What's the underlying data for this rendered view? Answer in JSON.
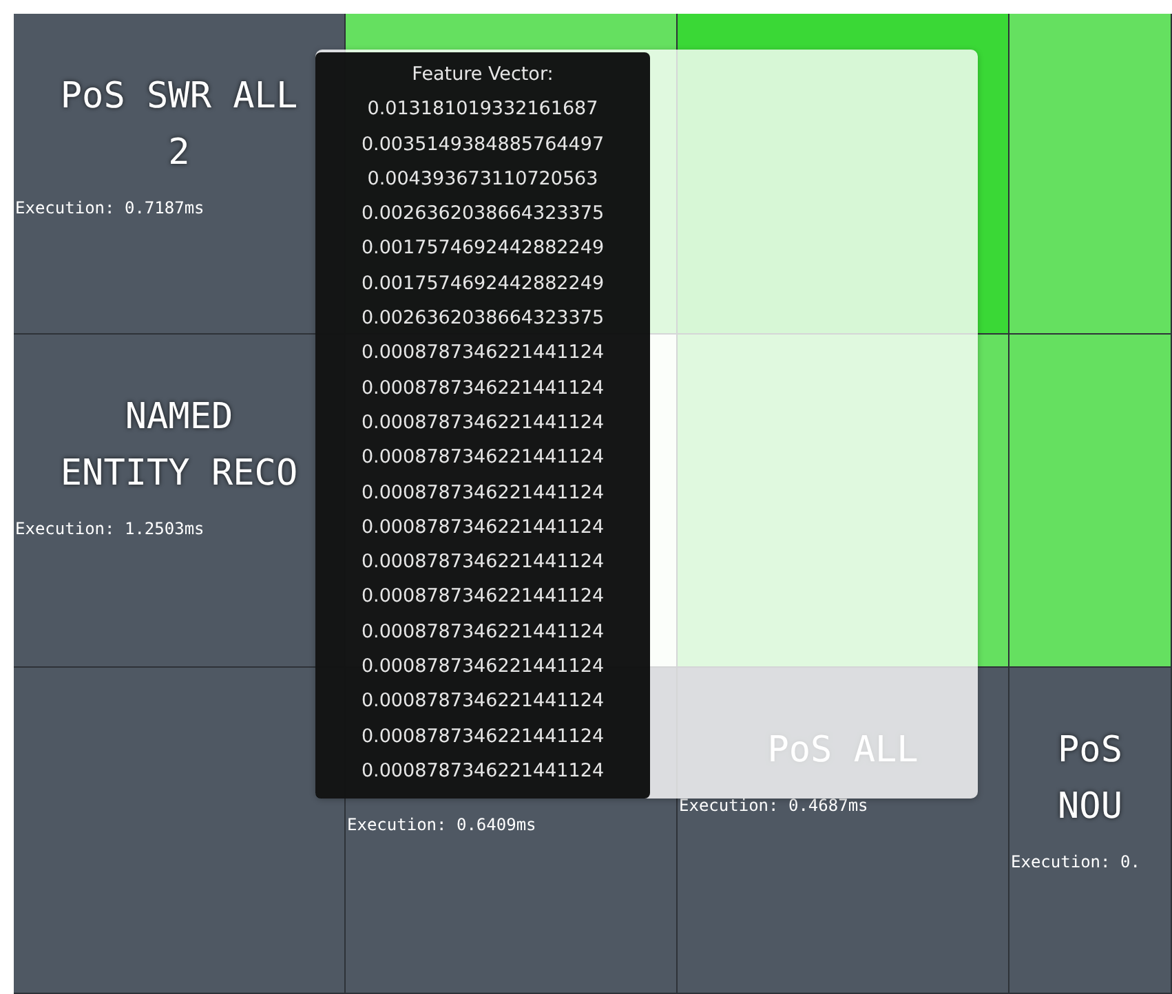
{
  "grid": {
    "cells": [
      {
        "kind": "model",
        "title": "PoS SWR ALL 2",
        "execution": "Execution: 0.7187ms"
      },
      {
        "kind": "swatch",
        "color": "#65e060"
      },
      {
        "kind": "swatch",
        "color": "#3ad836"
      },
      {
        "kind": "swatch",
        "color": "#65e060"
      },
      {
        "kind": "model",
        "title": "NAMED ENTITY RECO",
        "execution": "Execution: 1.2503ms"
      },
      {
        "kind": "covered"
      },
      {
        "kind": "swatch",
        "color": "#65e060"
      },
      {
        "kind": "swatch",
        "color": "#65e060"
      },
      {
        "kind": "model"
      },
      {
        "kind": "model",
        "execution": "Execution: 0.6409ms"
      },
      {
        "kind": "model",
        "title": "PoS ALL",
        "execution": "Execution: 0.4687ms"
      },
      {
        "kind": "model",
        "title": "PoS NOU",
        "execution": "Execution: 0."
      }
    ]
  },
  "tooltip": {
    "heading": "Feature Vector:",
    "values": [
      "0.013181019332161687",
      "0.0035149384885764497",
      "0.004393673110720563",
      "0.0026362038664323375",
      "0.0017574692442882249",
      "0.0017574692442882249",
      "0.0026362038664323375",
      "0.0008787346221441124",
      "0.0008787346221441124",
      "0.0008787346221441124",
      "0.0008787346221441124",
      "0.0008787346221441124",
      "0.0008787346221441124",
      "0.0008787346221441124",
      "0.0008787346221441124",
      "0.0008787346221441124",
      "0.0008787346221441124",
      "0.0008787346221441124",
      "0.0008787346221441124",
      "0.0008787346221441124"
    ]
  }
}
